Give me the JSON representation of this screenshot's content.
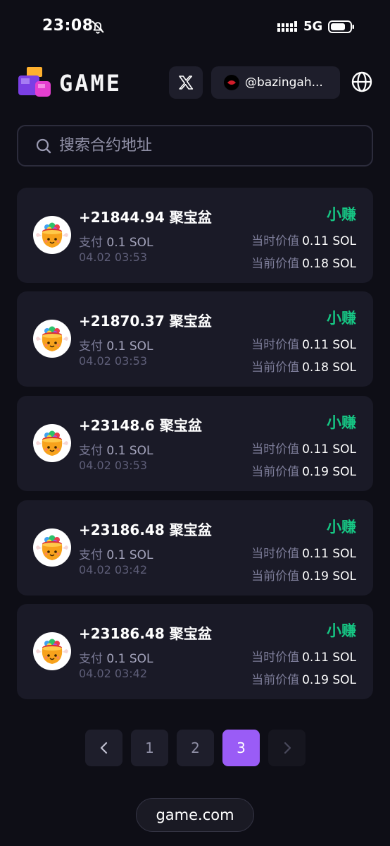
{
  "status_bar": {
    "time": "23:08",
    "network": "5G"
  },
  "header": {
    "brand": "GAME",
    "username": "@bazingah..."
  },
  "search": {
    "placeholder": "搜索合约地址"
  },
  "cards": [
    {
      "amount": "+21844.94",
      "name": "聚宝盆",
      "badge": "小赚",
      "pay_label": "支付",
      "pay_value": "0.1 SOL",
      "date": "04.02 03:53",
      "then_label": "当时价值",
      "then_value": "0.11 SOL",
      "now_label": "当前价值",
      "now_value": "0.18 SOL"
    },
    {
      "amount": "+21870.37",
      "name": "聚宝盆",
      "badge": "小赚",
      "pay_label": "支付",
      "pay_value": "0.1 SOL",
      "date": "04.02 03:53",
      "then_label": "当时价值",
      "then_value": "0.11 SOL",
      "now_label": "当前价值",
      "now_value": "0.18 SOL"
    },
    {
      "amount": "+23148.6",
      "name": "聚宝盆",
      "badge": "小赚",
      "pay_label": "支付",
      "pay_value": "0.1 SOL",
      "date": "04.02 03:53",
      "then_label": "当时价值",
      "then_value": "0.11 SOL",
      "now_label": "当前价值",
      "now_value": "0.19 SOL"
    },
    {
      "amount": "+23186.48",
      "name": "聚宝盆",
      "badge": "小赚",
      "pay_label": "支付",
      "pay_value": "0.1 SOL",
      "date": "04.02 03:42",
      "then_label": "当时价值",
      "then_value": "0.11 SOL",
      "now_label": "当前价值",
      "now_value": "0.19 SOL"
    },
    {
      "amount": "+23186.48",
      "name": "聚宝盆",
      "badge": "小赚",
      "pay_label": "支付",
      "pay_value": "0.1 SOL",
      "date": "04.02 03:42",
      "then_label": "当时价值",
      "then_value": "0.11 SOL",
      "now_label": "当前价值",
      "now_value": "0.19 SOL"
    }
  ],
  "pagination": {
    "pages": [
      "1",
      "2",
      "3"
    ],
    "current": "3"
  },
  "footer": {
    "domain": "game.com"
  },
  "colors": {
    "background": "#0e0e16",
    "card": "#1a1a27",
    "accent": "#9a5cf6",
    "profit": "#16c784"
  },
  "icons": [
    "bell-off-icon",
    "signal-icon",
    "battery-icon",
    "x-logo-icon",
    "globe-icon",
    "search-icon",
    "chevron-left-icon",
    "chevron-right-icon",
    "treasure-pot-icon"
  ]
}
